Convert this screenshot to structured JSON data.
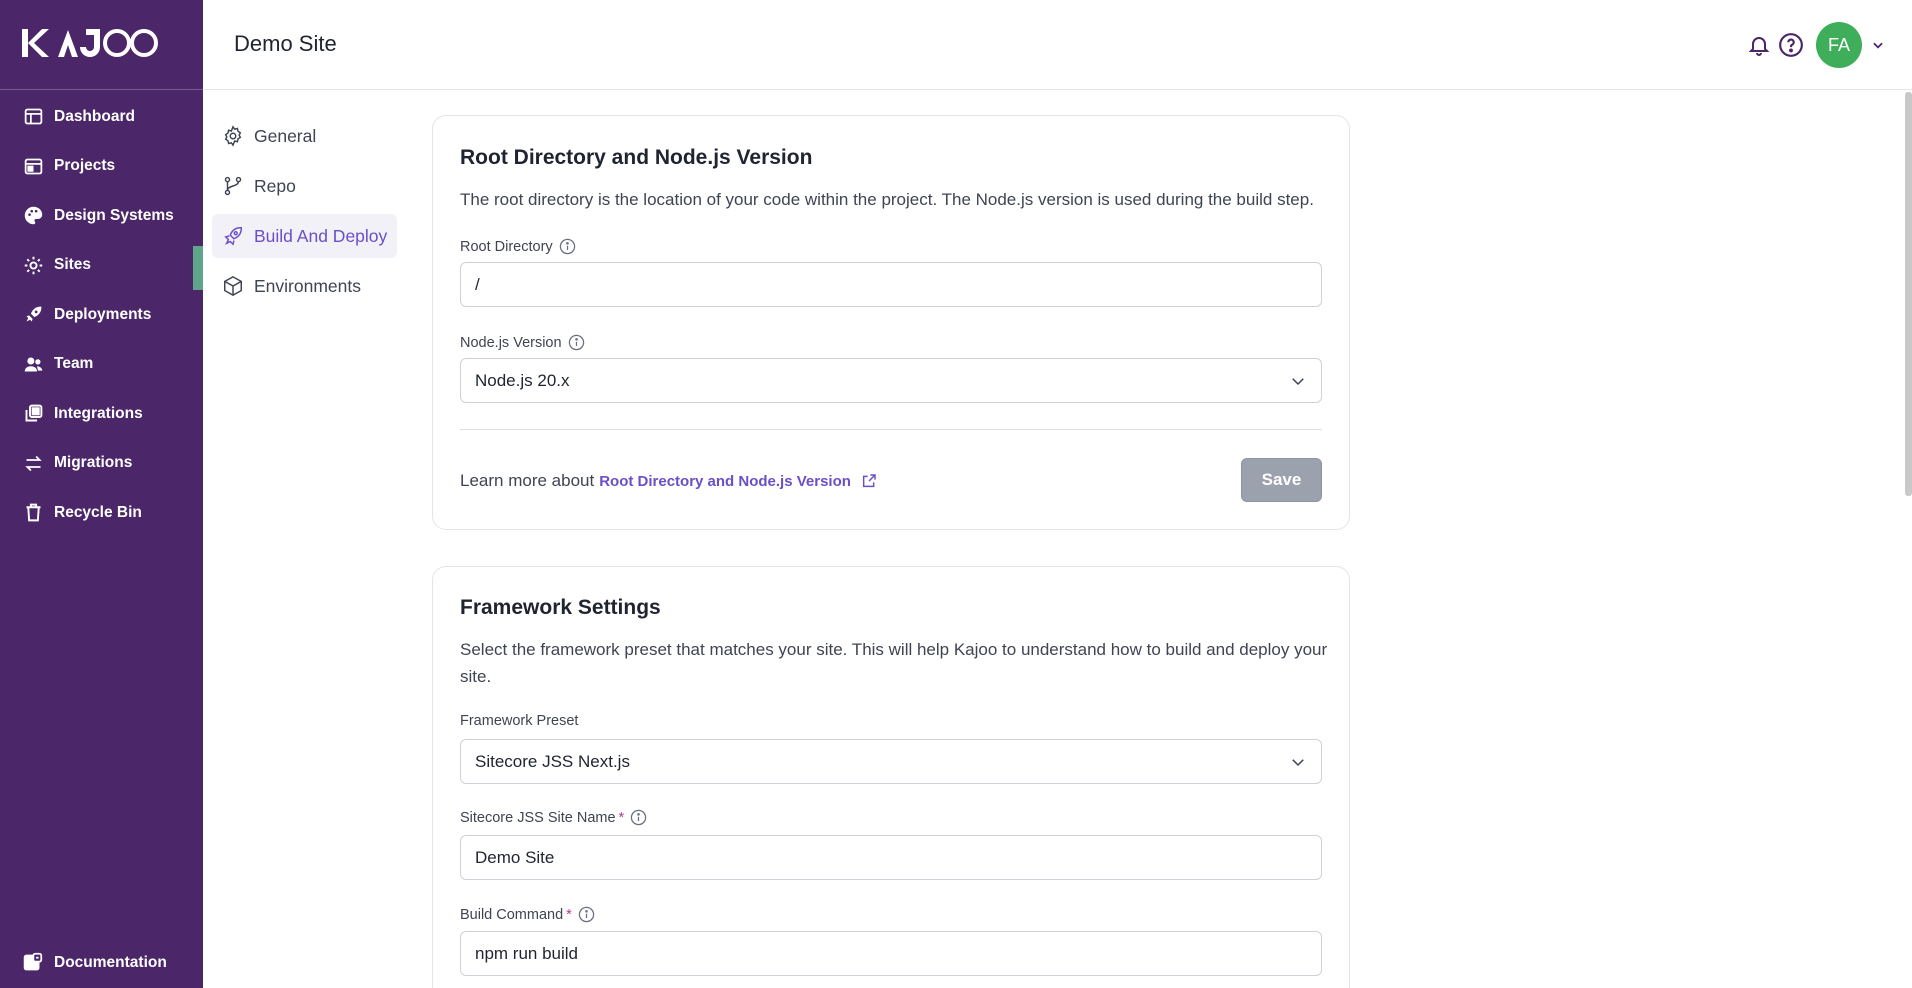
{
  "app": {
    "logo_text": "KAJOO",
    "site_title": "Demo Site"
  },
  "sidebar": {
    "items": [
      {
        "label": "Dashboard",
        "icon": "dashboard-icon"
      },
      {
        "label": "Projects",
        "icon": "projects-icon"
      },
      {
        "label": "Design Systems",
        "icon": "palette-icon"
      },
      {
        "label": "Sites",
        "icon": "gear-icon",
        "active": true
      },
      {
        "label": "Deployments",
        "icon": "rocket-icon"
      },
      {
        "label": "Team",
        "icon": "team-icon"
      },
      {
        "label": "Integrations",
        "icon": "integrations-icon"
      },
      {
        "label": "Migrations",
        "icon": "arrows-icon"
      },
      {
        "label": "Recycle Bin",
        "icon": "trash-icon"
      }
    ],
    "documentation": "Documentation"
  },
  "header": {
    "avatar_initials": "FA"
  },
  "subnav": {
    "items": [
      {
        "label": "General",
        "icon": "gear-icon"
      },
      {
        "label": "Repo",
        "icon": "branch-icon"
      },
      {
        "label": "Build And Deploy",
        "icon": "rocket-icon",
        "active": true
      },
      {
        "label": "Environments",
        "icon": "cube-icon"
      }
    ]
  },
  "root_card": {
    "title": "Root Directory and Node.js Version",
    "description": "The root directory is the location of your code within the project. The Node.js version is used during the build step.",
    "root_label": "Root Directory",
    "root_value": "/",
    "node_label": "Node.js Version",
    "node_value": "Node.js 20.x",
    "learn_prefix": "Learn more about",
    "learn_link": "Root Directory and Node.js Version",
    "save_label": "Save"
  },
  "framework_card": {
    "title": "Framework Settings",
    "description": "Select the framework preset that matches your site. This will help Kajoo to understand how to build and deploy your site.",
    "preset_label": "Framework Preset",
    "preset_value": "Sitecore JSS Next.js",
    "site_name_label": "Sitecore JSS Site Name",
    "site_name_value": "Demo Site",
    "build_label": "Build Command",
    "build_value": "npm run build",
    "required_mark": "*"
  },
  "colors": {
    "sidebar_bg": "#4b2668",
    "accent": "#6a4fc7",
    "active_marker": "#5fa58c",
    "avatar_bg": "#3fae5a",
    "save_disabled": "#9ba2ae"
  }
}
